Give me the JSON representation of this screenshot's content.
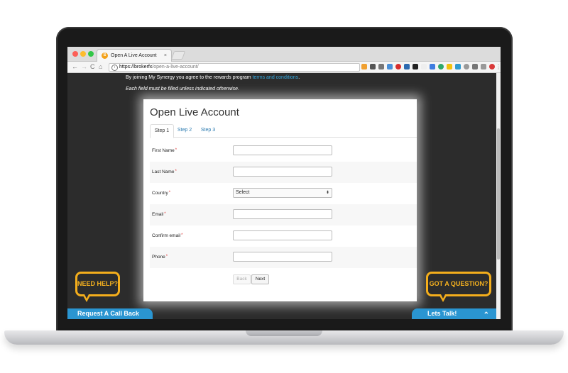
{
  "browser": {
    "tab_title": "Open A Live Account",
    "tab_favicon": "S",
    "tab_close": "×",
    "url_host": "https://brokerfx",
    "url_path": "/open-a-live-account/",
    "nav": {
      "back": "←",
      "forward": "→",
      "reload": "C",
      "home": "⌂"
    },
    "menu": "⋮"
  },
  "page": {
    "notice_prefix": "By joining My Synergy you agree to the rewards program ",
    "notice_link": "terms and conditions",
    "notice_suffix": ".",
    "required_note": "Each field must be filled unless indicated otherwise."
  },
  "form": {
    "title": "Open Live Account",
    "steps": [
      "Step 1",
      "Step 2",
      "Step 3"
    ],
    "active_step": 0,
    "fields": [
      {
        "label": "First Name",
        "type": "text",
        "value": ""
      },
      {
        "label": "Last Name",
        "type": "text",
        "value": ""
      },
      {
        "label": "Country",
        "type": "select",
        "value": "Select"
      },
      {
        "label": "Email",
        "type": "text",
        "value": ""
      },
      {
        "label": "Confirm email",
        "type": "text",
        "value": ""
      },
      {
        "label": "Phone",
        "type": "text",
        "value": ""
      }
    ],
    "required_mark": "*",
    "back_label": "Back",
    "next_label": "Next"
  },
  "widgets": {
    "need_help": "NEED HELP?",
    "request_call": "Request A Call Back",
    "got_question": "GOT A QUESTION?",
    "lets_talk": "Lets Talk!",
    "lets_talk_chevron": "⌃"
  },
  "colors": {
    "accent_yellow": "#f4ae1c",
    "cta_blue": "#2a95d1",
    "link_blue": "#34a9e0",
    "page_bg": "#2c2c2c"
  }
}
